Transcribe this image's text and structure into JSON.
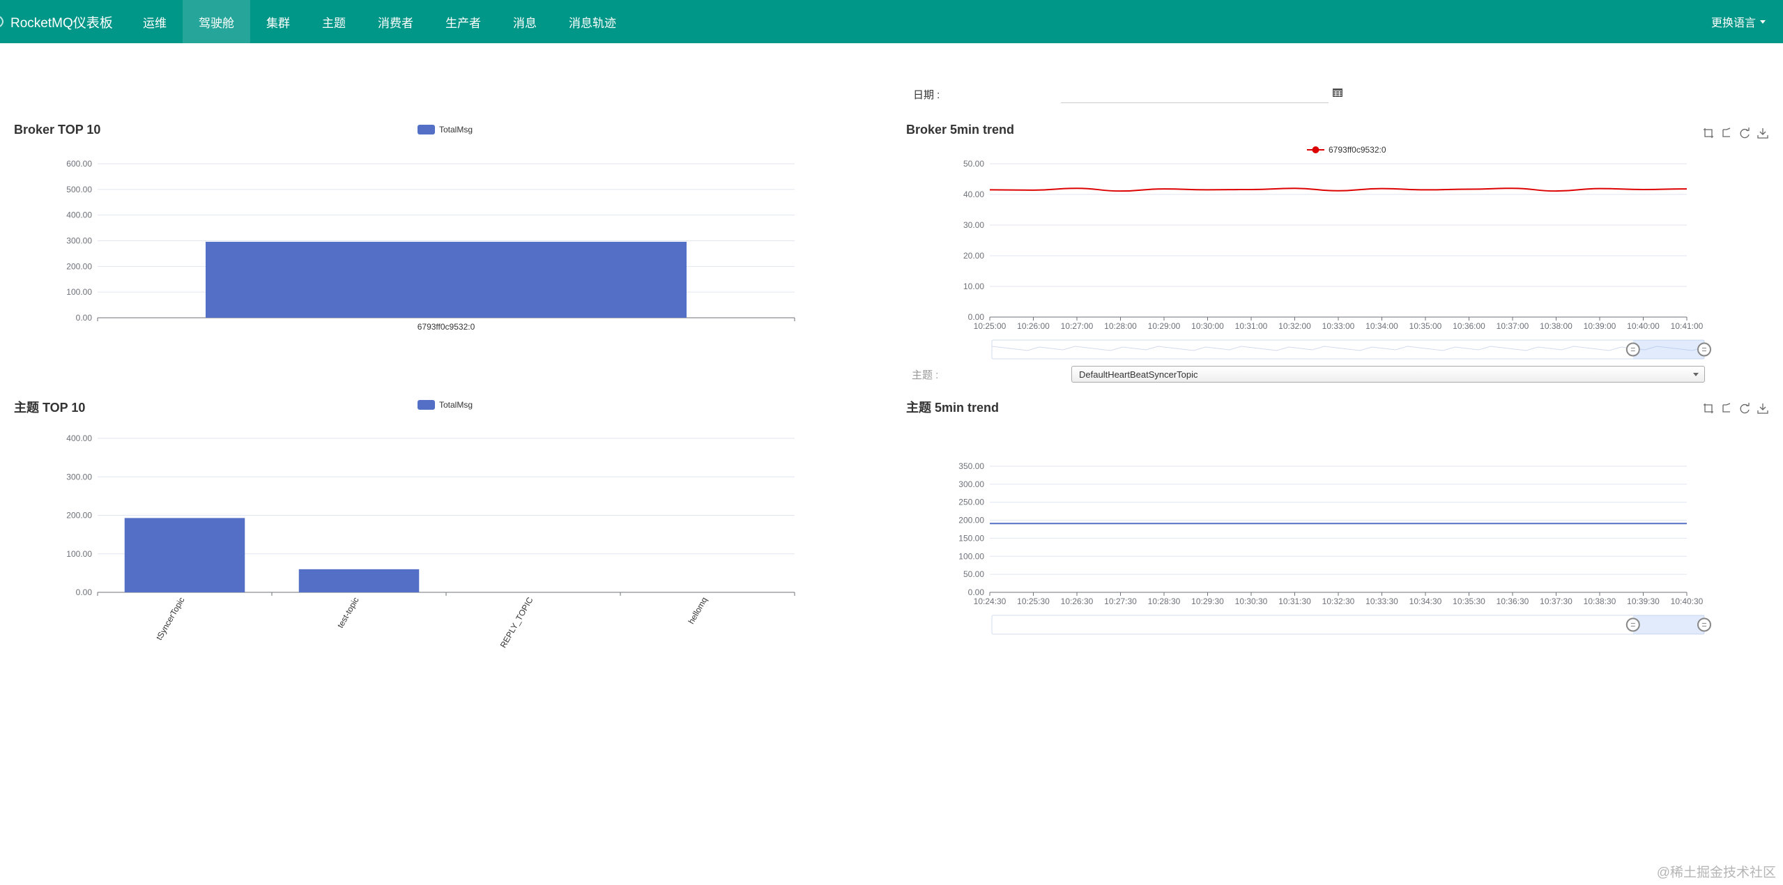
{
  "navbar": {
    "brand": "RocketMQ仪表板",
    "items": [
      "运维",
      "驾驶舱",
      "集群",
      "主题",
      "消费者",
      "生产者",
      "消息",
      "消息轨迹"
    ],
    "active": "驾驶舱",
    "language": "更换语言"
  },
  "date": {
    "label": "日期 :",
    "value": ""
  },
  "broker_top10": {
    "title": "Broker TOP 10",
    "legend": "TotalMsg"
  },
  "broker_trend": {
    "title": "Broker 5min trend",
    "legend": "6793ff0c9532:0"
  },
  "topic_filter": {
    "label": "主题 :",
    "selected": "DefaultHeartBeatSyncerTopic"
  },
  "topic_top10": {
    "title": "主题 TOP 10",
    "legend": "TotalMsg"
  },
  "topic_trend": {
    "title": "主题 5min trend"
  },
  "watermark": "@稀土掘金技术社区",
  "colors": {
    "navbar": "#009688",
    "navbar_active": "#26a69a",
    "bar": "#5470c6",
    "line_red": "#dd0000",
    "line_blue": "#5470c6"
  },
  "chart_data": [
    {
      "type": "bar",
      "id": "broker-top10",
      "categories": [
        "6793ff0c9532:0"
      ],
      "series": [
        {
          "name": "TotalMsg",
          "values": [
            296
          ]
        }
      ],
      "ylim": [
        0,
        600
      ],
      "yticks": [
        "0.00",
        "100.00",
        "200.00",
        "300.00",
        "400.00",
        "500.00",
        "600.00"
      ],
      "grid": true,
      "legend_position": "top-center"
    },
    {
      "type": "line",
      "id": "broker-trend",
      "x": [
        "10:25:00",
        "10:26:00",
        "10:27:00",
        "10:28:00",
        "10:29:00",
        "10:30:00",
        "10:31:00",
        "10:32:00",
        "10:33:00",
        "10:34:00",
        "10:35:00",
        "10:36:00",
        "10:37:00",
        "10:38:00",
        "10:39:00",
        "10:40:00",
        "10:41:00"
      ],
      "series": [
        {
          "name": "6793ff0c9532:0",
          "values": [
            41.5,
            41.4,
            42.0,
            41.1,
            41.8,
            41.5,
            41.6,
            42.0,
            41.2,
            41.9,
            41.5,
            41.7,
            42.0,
            41.1,
            41.9,
            41.6,
            41.8
          ]
        }
      ],
      "ylim": [
        0,
        50
      ],
      "yticks": [
        "0.00",
        "10.00",
        "20.00",
        "30.00",
        "40.00",
        "50.00"
      ],
      "grid": true,
      "legend_position": "top-center",
      "datazoom": {
        "start": 0.9,
        "end": 1.0
      }
    },
    {
      "type": "bar",
      "id": "topic-top10",
      "categories": [
        "tSyncerTopic",
        "test-topic",
        "REPLY_TOPIC",
        "hellomq"
      ],
      "series": [
        {
          "name": "TotalMsg",
          "values": [
            193,
            60,
            0,
            0
          ]
        }
      ],
      "ylim": [
        0,
        400
      ],
      "yticks": [
        "0.00",
        "100.00",
        "200.00",
        "300.00",
        "400.00"
      ],
      "grid": true,
      "legend_position": "top-center"
    },
    {
      "type": "line",
      "id": "topic-trend",
      "x": [
        "10:24:30",
        "10:25:30",
        "10:26:30",
        "10:27:30",
        "10:28:30",
        "10:29:30",
        "10:30:30",
        "10:31:30",
        "10:32:30",
        "10:33:30",
        "10:34:30",
        "10:35:30",
        "10:36:30",
        "10:37:30",
        "10:38:30",
        "10:39:30",
        "10:40:30"
      ],
      "series": [
        {
          "values": [
            191,
            191,
            191,
            191,
            191,
            191,
            191,
            191,
            191,
            191,
            191,
            191,
            191,
            191,
            191,
            191,
            191
          ]
        }
      ],
      "ylim": [
        0,
        350
      ],
      "yticks": [
        "0.00",
        "50.00",
        "100.00",
        "150.00",
        "200.00",
        "250.00",
        "300.00",
        "350.00"
      ],
      "grid": true,
      "datazoom": {
        "start": 0.9,
        "end": 1.0
      }
    }
  ]
}
